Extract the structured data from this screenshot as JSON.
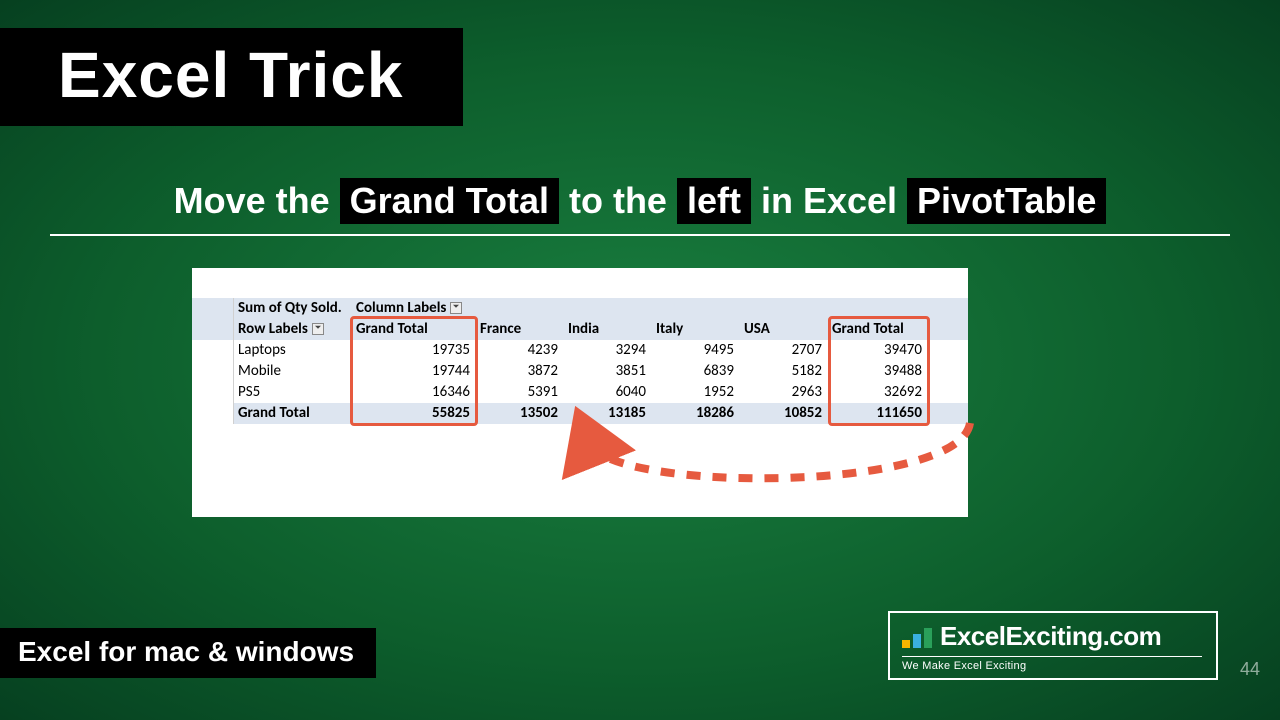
{
  "title": "Excel Trick",
  "subtitle": {
    "p1": "Move the ",
    "h1": "Grand Total",
    "p2": " to the ",
    "h2": "left",
    "p3": " in Excel ",
    "h3": "PivotTable"
  },
  "pivot": {
    "sum_label": "Sum of Qty Sold.",
    "col_labels": "Column Labels",
    "row_labels": "Row Labels",
    "gt": "Grand Total",
    "cols": [
      "Grand Total",
      "France",
      "India",
      "Italy",
      "USA",
      "Grand Total"
    ],
    "rows": [
      {
        "label": "Laptops",
        "vals": [
          "19735",
          "4239",
          "3294",
          "9495",
          "2707",
          "39470"
        ]
      },
      {
        "label": "Mobile",
        "vals": [
          "19744",
          "3872",
          "3851",
          "6839",
          "5182",
          "39488"
        ]
      },
      {
        "label": "PS5",
        "vals": [
          "16346",
          "5391",
          "6040",
          "1952",
          "2963",
          "32692"
        ]
      }
    ],
    "grand": {
      "label": "Grand Total",
      "vals": [
        "55825",
        "13502",
        "13185",
        "18286",
        "10852",
        "111650"
      ]
    }
  },
  "footer_left": "Excel for mac & windows",
  "brand": {
    "name": "ExcelExciting.com",
    "tag": "We Make Excel Exciting"
  },
  "page_number": "44"
}
